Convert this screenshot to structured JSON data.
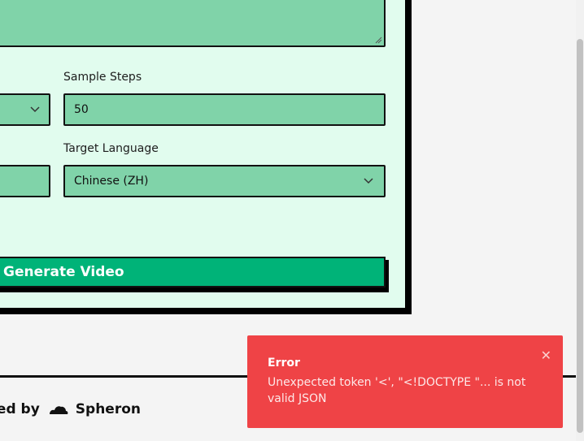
{
  "form": {
    "sample_steps": {
      "label": "Sample Steps",
      "value": "50"
    },
    "target_language": {
      "label": "Target Language",
      "value": "Chinese (ZH)"
    },
    "generate_label": "Generate Video"
  },
  "footer": {
    "powered_prefix": "ered by",
    "brand": "Spheron"
  },
  "toast": {
    "title": "Error",
    "message": "Unexpected token '<', \"<!DOCTYPE \"... is not valid JSON",
    "close_glyph": "✕"
  },
  "colors": {
    "page_bg": "#f4f4f4",
    "card_bg": "#e1fcee",
    "field_bg": "#80d3a9",
    "button_bg": "#00b378",
    "toast_bg": "#ef4346"
  }
}
